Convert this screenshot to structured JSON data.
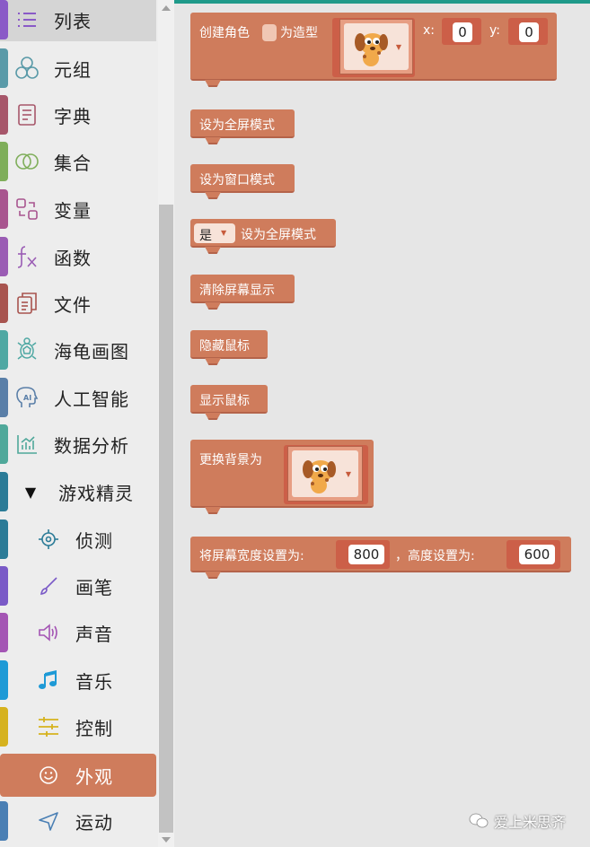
{
  "sidebar": {
    "items": [
      {
        "label": "列表",
        "icon": "list-icon",
        "color": "#8a5ac7"
      },
      {
        "label": "元组",
        "icon": "tuple-icon",
        "color": "#5a9aa8"
      },
      {
        "label": "字典",
        "icon": "dictionary-icon",
        "color": "#a7566a"
      },
      {
        "label": "集合",
        "icon": "set-icon",
        "color": "#7fae5a"
      },
      {
        "label": "变量",
        "icon": "variable-icon",
        "color": "#a8558f"
      },
      {
        "label": "函数",
        "icon": "function-icon",
        "color": "#9a5cb4"
      },
      {
        "label": "文件",
        "icon": "file-icon",
        "color": "#a8544f"
      },
      {
        "label": "海龟画图",
        "icon": "turtle-icon",
        "color": "#4fa8a3"
      },
      {
        "label": "人工智能",
        "icon": "ai-icon",
        "color": "#5a7fa8"
      },
      {
        "label": "数据分析",
        "icon": "chart-icon",
        "color": "#4fa89a"
      }
    ],
    "group": {
      "label": "游戏精灵",
      "arrow": "▼",
      "color": "#2b7b97"
    },
    "sub_items": [
      {
        "label": "侦测",
        "icon": "detect-icon",
        "color": "#2b7b97"
      },
      {
        "label": "画笔",
        "icon": "pen-icon",
        "color": "#7a5ac7"
      },
      {
        "label": "声音",
        "icon": "sound-icon",
        "color": "#a455b4"
      },
      {
        "label": "音乐",
        "icon": "music-icon",
        "color": "#1e9ad6"
      },
      {
        "label": "控制",
        "icon": "control-icon",
        "color": "#d6b21e"
      },
      {
        "label": "外观",
        "icon": "smile-icon",
        "color": "#cf7c5c"
      },
      {
        "label": "运动",
        "icon": "motion-icon",
        "color": "#4a7fb4"
      }
    ]
  },
  "blocks": {
    "create_sprite": {
      "text1": "创建角色",
      "text2": "为造型",
      "x_label": "x:",
      "x_value": "0",
      "y_label": "y:",
      "y_value": "0"
    },
    "fullscreen": "设为全屏模式",
    "window_mode": "设为窗口模式",
    "toggle_fullscreen": {
      "value": "是",
      "text": "设为全屏模式"
    },
    "clear_screen": "清除屏幕显示",
    "hide_mouse": "隐藏鼠标",
    "show_mouse": "显示鼠标",
    "set_background": "更换背景为",
    "set_screen_size": {
      "text1": "将屏幕宽度设置为:",
      "width": "800",
      "text2": "，高度设置为:",
      "height": "600"
    }
  },
  "watermark": "爱上米思齐",
  "colors": {
    "block": "#cf7c5c",
    "block_dark": "#b4634a",
    "accent": "#1f9a8a",
    "workspace": "#e6e6e6"
  }
}
